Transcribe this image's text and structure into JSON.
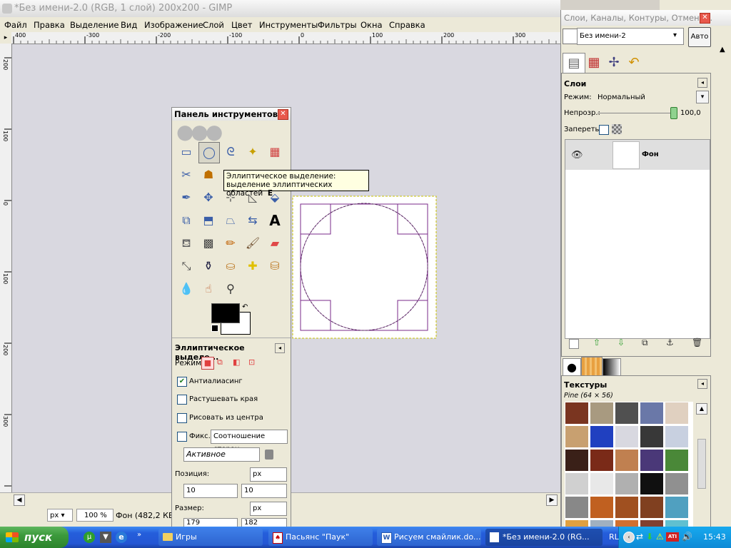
{
  "window": {
    "title": "*Без имени-2.0 (RGB, 1 слой) 200x200 - GIMP",
    "controls": [
      "_",
      "□",
      "✕"
    ]
  },
  "menu": [
    "Файл",
    "Правка",
    "Выделение",
    "Вид",
    "Изображение",
    "Слой",
    "Цвет",
    "Инструменты",
    "Фильтры",
    "Окна",
    "Справка"
  ],
  "ruler_top": [
    "400",
    "-300",
    "-200",
    "-100",
    "0",
    "100",
    "200",
    "300"
  ],
  "ruler_left": [
    "200",
    "100",
    "0",
    "100",
    "200",
    "300"
  ],
  "status": {
    "unit": "px",
    "zoom": "100 %",
    "info": "Фон (482,2 КБ)"
  },
  "toolbox": {
    "title": "Панель инструментов",
    "tooltip_line1": "Эллиптическое выделение:",
    "tooltip_line2": "выделение эллиптических областей",
    "tooltip_key": "E",
    "options_title": "Эллиптическое выделе...",
    "mode_label": "Режим:",
    "antialias": "Антиалиасинг",
    "feather": "Растушевать края",
    "from_center": "Рисовать из центра",
    "fixed_label": "Фикс.:",
    "fixed_value": "Соотношение сторон",
    "active_value": "Активное",
    "position_label": "Позиция:",
    "position_unit": "px",
    "pos_x": "10",
    "pos_y": "10",
    "size_label": "Размер:",
    "size_unit": "px",
    "size_w": "179",
    "size_h": "182"
  },
  "dock": {
    "title": "Слои, Каналы, Контуры, Отмени...",
    "image_name": "Без имени-2",
    "auto_button": "Авто",
    "layers_title": "Слои",
    "mode_label": "Режим:",
    "mode_value": "Нормальный",
    "opacity_label": "Непрозр.:",
    "opacity_value": "100,0",
    "lock_label": "Запереть:",
    "layer_name": "Фон",
    "textures_title": "Текстуры",
    "texture_selected": "Pine (64 × 56)"
  },
  "textures": [
    "#7a3520",
    "#a89a80",
    "#505050",
    "#6a78a8",
    "#e0d0c0",
    "#c8a070",
    "#2040c0",
    "#d8d8e0",
    "#383838",
    "#c8d0e0",
    "#3a2018",
    "#7a2a18",
    "#c08050",
    "#4a3878",
    "#4a8838",
    "#d0d0d0",
    "#e8e8e8",
    "#b0b0b0",
    "#101010",
    "#909090",
    "#888888",
    "#c06020",
    "#a05020",
    "#804020",
    "#50a0c0",
    "#e0a040",
    "#a0b0c0",
    "#d07030",
    "#804030",
    "#60c0d0"
  ],
  "taskbar": {
    "start": "пуск",
    "tasks": [
      "Игры",
      "Пасьянс \"Паук\"",
      "Рисуем смайлик.do...",
      "*Без имени-2.0 (RG..."
    ],
    "lang": "RL",
    "clock": "15:43"
  },
  "colors": {
    "selection": "#7a2a8a",
    "fg": "#000000",
    "bg": "#ffffff",
    "xp_blue": "#245edb"
  }
}
